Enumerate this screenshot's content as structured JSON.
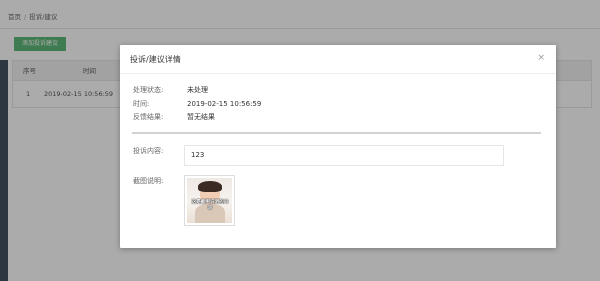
{
  "breadcrumb": {
    "home": "首页",
    "separator": "/",
    "current": "投诉/建议"
  },
  "toolbar": {
    "add_label": "添加投诉建议"
  },
  "table": {
    "headers": [
      "序号",
      "时间"
    ],
    "rows": [
      {
        "no": "1",
        "time": "2019-02-15 10:56:59"
      }
    ]
  },
  "modal": {
    "title": "投诉/建议详情",
    "close": "×",
    "status_label": "处理状态:",
    "status_value": "未处理",
    "time_label": "时间:",
    "time_value": "2019-02-15 10:56:59",
    "feedback_label": "反馈结果:",
    "feedback_value": "暂无结果",
    "content_label": "投诉内容:",
    "content_value": "123",
    "screenshot_label": "截图说明:",
    "screenshot_caption": "这是截图说明的内容"
  },
  "colors": {
    "accent": "#5fb878",
    "overlay": "rgba(0,0,0,0.33)"
  }
}
